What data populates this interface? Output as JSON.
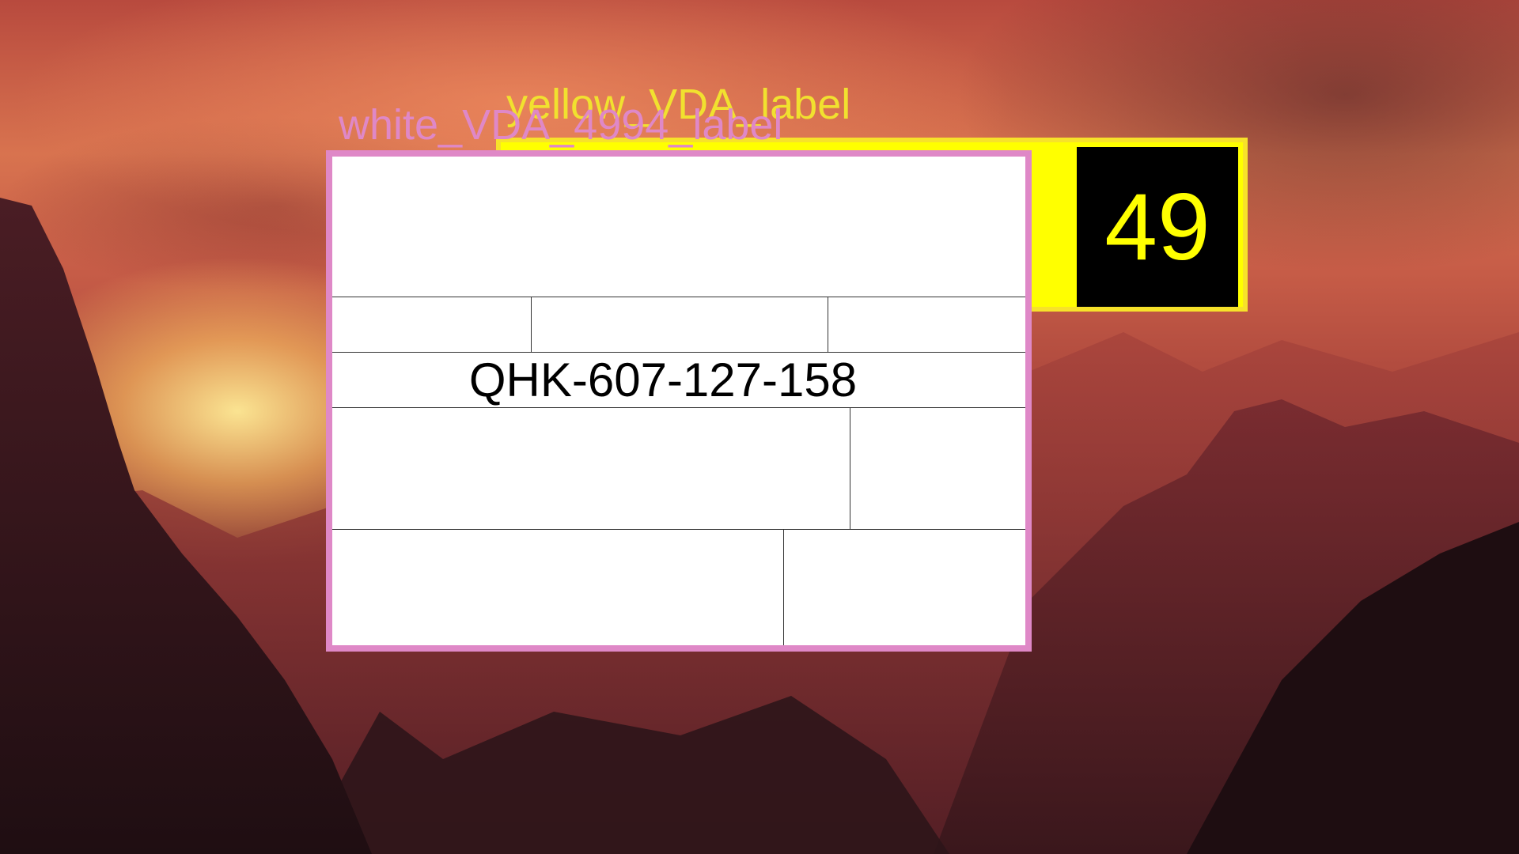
{
  "background": {
    "description_colors": {
      "sky_top": "#b84a3e",
      "sky_glow": "#ffe196",
      "mountain_dark": "#2c1418"
    }
  },
  "yellow_window": {
    "label": "yellow_VDA_label",
    "badge_value": "49",
    "border_color": "#f7e22a",
    "fill_color": "#ffff00"
  },
  "white_window": {
    "label": "white_VDA_4994_label",
    "border_color": "#df88c7",
    "serial": "QHK-607-127-158"
  }
}
